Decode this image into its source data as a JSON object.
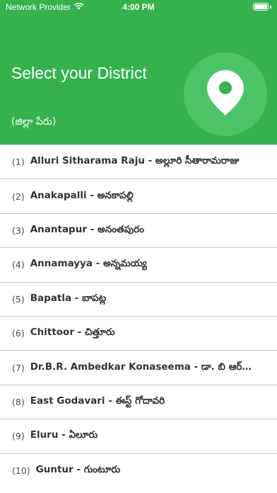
{
  "status_bar": {
    "carrier": "Network Provider",
    "time": "4:00 PM"
  },
  "header": {
    "title": "Select your District",
    "subtitle": "(జిల్లా పేరు)"
  },
  "districts": [
    {
      "num": "(1)",
      "name": "Alluri Sitharama Raju - అల్లూరి సీతారామరాజు"
    },
    {
      "num": "(2)",
      "name": "Anakapalli - అనకాపల్లి"
    },
    {
      "num": "(3)",
      "name": "Anantapur - అనంతపురం"
    },
    {
      "num": "(4)",
      "name": "Annamayya - అన్నమయ్య"
    },
    {
      "num": "(5)",
      "name": "Bapatla - బాపట్ల"
    },
    {
      "num": "(6)",
      "name": "Chittoor - చిత్తూరు"
    },
    {
      "num": "(7)",
      "name": "Dr.B.R. Ambedkar Konaseema - డా. బి ఆర్…"
    },
    {
      "num": "(8)",
      "name": "East Godavari - ఈస్ట్ గోదావరి"
    },
    {
      "num": "(9)",
      "name": "Eluru - ఏలూరు"
    },
    {
      "num": "(10)",
      "name": "Guntur - గుంటూరు"
    }
  ],
  "colors": {
    "header_bg": "#35b24f",
    "circle_bg": "#4cc366",
    "divider": "#c9c9c9"
  },
  "icons": {
    "wifi": "wifi-icon",
    "battery": "battery-icon",
    "location": "location-pin-icon"
  }
}
